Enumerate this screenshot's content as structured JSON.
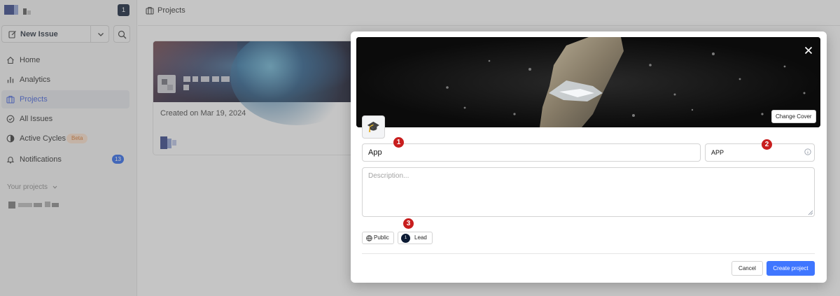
{
  "sidebar": {
    "user_badge": "1",
    "new_issue_label": "New Issue",
    "nav": [
      {
        "label": "Home"
      },
      {
        "label": "Analytics"
      },
      {
        "label": "Projects"
      },
      {
        "label": "All Issues"
      },
      {
        "label": "Active Cycles",
        "badge": "Beta"
      },
      {
        "label": "Notifications",
        "count": "13"
      }
    ],
    "your_projects_label": "Your projects"
  },
  "header": {
    "title": "Projects"
  },
  "project_card": {
    "created": "Created on Mar 19, 2024"
  },
  "modal": {
    "change_cover_label": "Change Cover",
    "emoji": "🎓",
    "name_value": "App",
    "identifier_value": "APP",
    "description_placeholder": "Description...",
    "network_label": "Public",
    "lead_avatar": "1",
    "lead_label": "Lead",
    "cancel_label": "Cancel",
    "create_label": "Create project"
  },
  "markers": [
    "1",
    "2",
    "3"
  ],
  "colors": {
    "accent": "#3f76ff",
    "marker": "#c81e1e",
    "active_nav": "#3b5bdb",
    "count_badge": "#2563eb",
    "beta_bg": "#fde2cc",
    "beta_text": "#d9762b"
  }
}
